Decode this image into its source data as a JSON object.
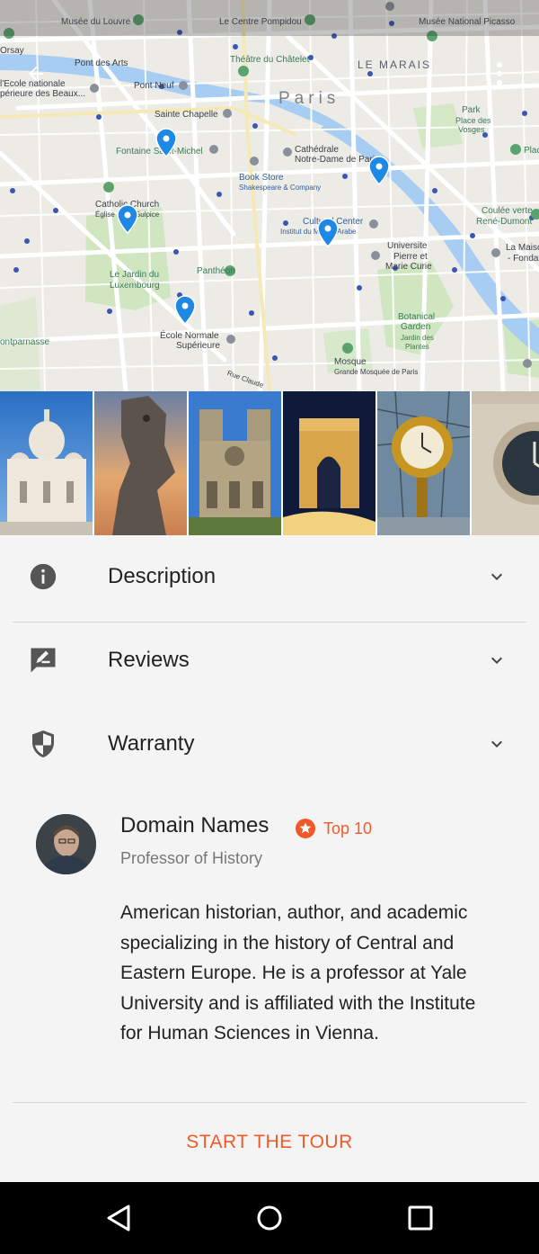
{
  "map": {
    "labels": {
      "musee_louvre": "Musée du Louvre",
      "centre_pompidou": "Le Centre Pompidou",
      "musee_picasso": "Musée National Picasso",
      "orsay": "Orsay",
      "pont_des_arts": "Pont des Arts",
      "theatre_chatelet": "Théâtre du Châtelet",
      "le_marais": "LE MARAIS",
      "ecole_nationale": "l'Ecole nationale",
      "beaux": "périeure des Beaux...",
      "pont_neuf": "Pont Neuf",
      "paris": "Paris",
      "park": "Park",
      "place_des_vosges_1": "Place des",
      "place_des_vosges_2": "Vosges",
      "sainte_chapelle": "Sainte Chapelle",
      "fontaine": "Fontaine Saint-Michel",
      "cathedrale_1": "Cathédrale",
      "cathedrale_2": "Notre-Dame de Paris",
      "plac": "Plac",
      "book_store": "Book Store",
      "shakespeare": "Shakespeare & Company",
      "catholic_church": "Catholic Church",
      "eglise": "Église Saint-Sulpice",
      "cultural_center": "Cultural Center",
      "institut": "Institut du Monde Arabe",
      "coulee_1": "Coulée verte",
      "coulee_2": "René-Dumont",
      "universite_1": "Universite",
      "universite_2": "Pierre et",
      "universite_3": "Marie Curie",
      "la_maison_1": "La Maiso",
      "la_maison_2": "- Fondat",
      "jardin_1": "Le Jardin du",
      "jardin_2": "Luxembourg",
      "pantheon": "Panthéon",
      "botanical_1": "Botanical",
      "botanical_2": "Garden",
      "botanical_3": "Jardin des",
      "botanical_4": "Plantes",
      "ecole_normale_1": "École Normale",
      "ecole_normale_2": "Supérieure",
      "montparnasse": "ontparnasse",
      "mosque": "Mosque",
      "grande_mosquee": "Grande Mosquée de Paris",
      "rue_claude": "Rue Claude"
    }
  },
  "accordion": [
    {
      "label": "Description",
      "icon": "info-icon"
    },
    {
      "label": "Reviews",
      "icon": "rate-review-icon"
    },
    {
      "label": "Warranty",
      "icon": "shield-icon"
    }
  ],
  "author": {
    "name": "Domain Names",
    "badge": "Top 10",
    "role": "Professor of History",
    "bio": "American historian, author, and academic specializing in the history of Central and Eastern Europe. He is a professor at Yale University and is affiliated with the Institute for Human Sciences in Vienna."
  },
  "cta": "START THE TOUR",
  "colors": {
    "accent": "#f05a28",
    "marker": "#1e88e5",
    "river": "#a7cdf2",
    "park": "#cfe6c1"
  }
}
